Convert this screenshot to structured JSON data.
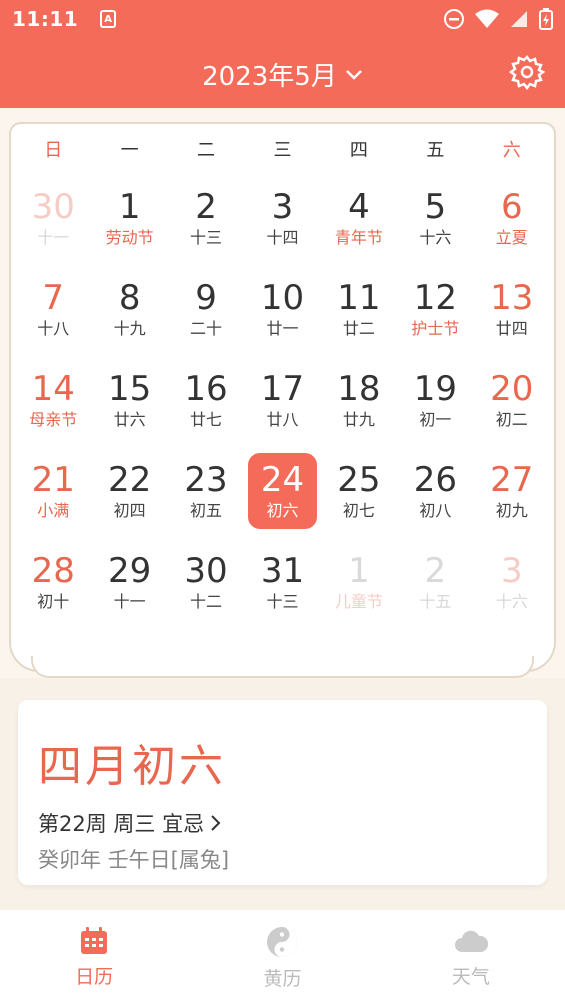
{
  "status_bar": {
    "time": "11:11",
    "notification_badge": "A"
  },
  "header": {
    "month_title": "2023年5月"
  },
  "weekdays": [
    "日",
    "一",
    "二",
    "三",
    "四",
    "五",
    "六"
  ],
  "calendar": [
    {
      "num": "30",
      "sub": "十一",
      "state": "other-prev",
      "fest": false
    },
    {
      "num": "1",
      "sub": "劳动节",
      "state": "",
      "fest": true
    },
    {
      "num": "2",
      "sub": "十三",
      "state": "",
      "fest": false
    },
    {
      "num": "3",
      "sub": "十四",
      "state": "",
      "fest": false
    },
    {
      "num": "4",
      "sub": "青年节",
      "state": "",
      "fest": true
    },
    {
      "num": "5",
      "sub": "十六",
      "state": "",
      "fest": false
    },
    {
      "num": "6",
      "sub": "立夏",
      "state": "",
      "fest": true
    },
    {
      "num": "7",
      "sub": "十八",
      "state": "",
      "fest": false
    },
    {
      "num": "8",
      "sub": "十九",
      "state": "",
      "fest": false
    },
    {
      "num": "9",
      "sub": "二十",
      "state": "",
      "fest": false
    },
    {
      "num": "10",
      "sub": "廿一",
      "state": "",
      "fest": false
    },
    {
      "num": "11",
      "sub": "廿二",
      "state": "",
      "fest": false
    },
    {
      "num": "12",
      "sub": "护士节",
      "state": "",
      "fest": true
    },
    {
      "num": "13",
      "sub": "廿四",
      "state": "",
      "fest": false
    },
    {
      "num": "14",
      "sub": "母亲节",
      "state": "",
      "fest": true
    },
    {
      "num": "15",
      "sub": "廿六",
      "state": "",
      "fest": false
    },
    {
      "num": "16",
      "sub": "廿七",
      "state": "",
      "fest": false
    },
    {
      "num": "17",
      "sub": "廿八",
      "state": "",
      "fest": false
    },
    {
      "num": "18",
      "sub": "廿九",
      "state": "",
      "fest": false
    },
    {
      "num": "19",
      "sub": "初一",
      "state": "",
      "fest": false
    },
    {
      "num": "20",
      "sub": "初二",
      "state": "",
      "fest": false
    },
    {
      "num": "21",
      "sub": "小满",
      "state": "",
      "fest": true
    },
    {
      "num": "22",
      "sub": "初四",
      "state": "",
      "fest": false
    },
    {
      "num": "23",
      "sub": "初五",
      "state": "",
      "fest": false
    },
    {
      "num": "24",
      "sub": "初六",
      "state": "today",
      "fest": false
    },
    {
      "num": "25",
      "sub": "初七",
      "state": "",
      "fest": false
    },
    {
      "num": "26",
      "sub": "初八",
      "state": "",
      "fest": false
    },
    {
      "num": "27",
      "sub": "初九",
      "state": "",
      "fest": false
    },
    {
      "num": "28",
      "sub": "初十",
      "state": "",
      "fest": false
    },
    {
      "num": "29",
      "sub": "十一",
      "state": "",
      "fest": false
    },
    {
      "num": "30",
      "sub": "十二",
      "state": "",
      "fest": false
    },
    {
      "num": "31",
      "sub": "十三",
      "state": "",
      "fest": false
    },
    {
      "num": "1",
      "sub": "儿童节",
      "state": "other-next",
      "fest": true
    },
    {
      "num": "2",
      "sub": "十五",
      "state": "other-next",
      "fest": false
    },
    {
      "num": "3",
      "sub": "十六",
      "state": "other-next",
      "fest": false
    }
  ],
  "info": {
    "lunar_date": "四月初六",
    "week_line": "第22周 周三 宜忌",
    "ganzhi": "癸卯年 壬午日[属兔]"
  },
  "bottom_nav": [
    {
      "label": "日历",
      "icon": "calendar-icon",
      "active": true
    },
    {
      "label": "黄历",
      "icon": "yin-yang-icon",
      "active": false
    },
    {
      "label": "天气",
      "icon": "cloud-icon",
      "active": false
    }
  ],
  "colors": {
    "accent": "#f46b5a",
    "festival": "#e8674f",
    "background": "#f8f1e8"
  }
}
